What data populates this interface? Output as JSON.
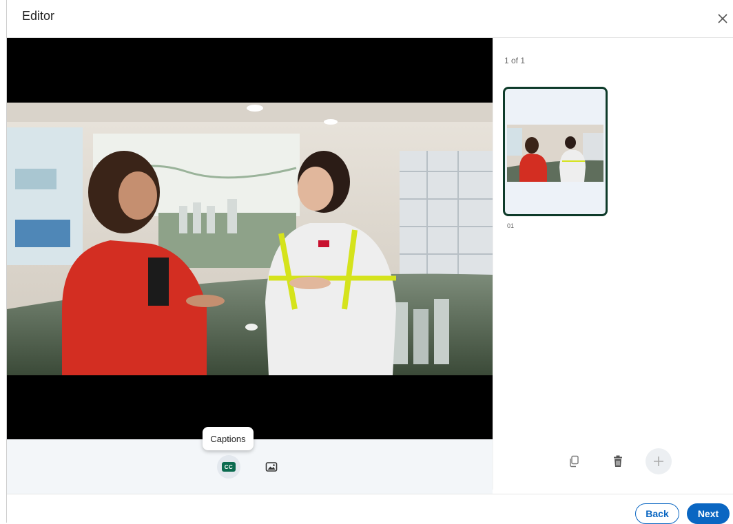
{
  "header": {
    "title": "Editor",
    "close_icon": "close-icon"
  },
  "toolbar": {
    "captions_tooltip": "Captions",
    "captions_badge": "CC",
    "captions_icon": "captions-icon",
    "image_icon": "image-icon"
  },
  "panel": {
    "counter": "1 of 1",
    "thumbnails": [
      {
        "label": "01",
        "selected": true
      }
    ],
    "copy_icon": "copy-icon",
    "delete_icon": "trash-icon",
    "add_icon": "plus-icon"
  },
  "footer": {
    "back_label": "Back",
    "next_label": "Next"
  },
  "colors": {
    "accent": "#0a66c2",
    "thumbnail_border": "#0e3b2a",
    "captions_badge": "#0b6b4f"
  }
}
